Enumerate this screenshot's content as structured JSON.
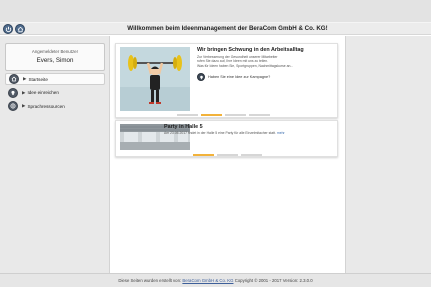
{
  "header": {
    "title": "Willkommen beim Ideenmanagement der BeraCom GmbH & Co. KG!",
    "power_icon": "power-icon",
    "home_icon": "home-icon"
  },
  "sidebar": {
    "user_label": "Angemeldeter Benutzer",
    "user_name": "Evers, Simon",
    "items": [
      {
        "label": "Startseite",
        "icon": "home-icon",
        "active": true
      },
      {
        "label": "Idee einreichen",
        "icon": "lightbulb-icon",
        "active": false
      },
      {
        "label": "Sprachressourcen",
        "icon": "globe-icon",
        "active": false
      }
    ]
  },
  "cards": [
    {
      "title": "Wir bringen Schwung in den Arbeitsalltag",
      "text_lines": [
        "Zur Verbesserung der Gesundheit unserer Mitarbeiter",
        "rufen Sie dazu auf, Ihre Ideen mit uns zu teilen.",
        "Was für Ideen haben Sie, Sportgruppen, Nachmittagskurse an..."
      ],
      "question": "Haben Sie eine Idee zur Kampagne?",
      "image": "weightlifter-illustration"
    },
    {
      "title": "Party in Halle 5",
      "text": "Am 23.05.2017 findet in der Halle 5 eine Party für alle Einzelmitacher statt.",
      "more": "mehr",
      "image": "hall-photo"
    }
  ],
  "footer": {
    "prefix": "Diese Seiten wurden erstellt von:",
    "company": "BeraCom GmbH & Co. KG",
    "copyright": "Copyright © 2001 - 2017",
    "version": "Version: 2.3.0.0"
  },
  "colors": {
    "accent": "#f2b23a",
    "icon_dark": "#4f6b8c",
    "sidebar_bg": "#e9e9e9",
    "link": "#3d6fb0"
  }
}
